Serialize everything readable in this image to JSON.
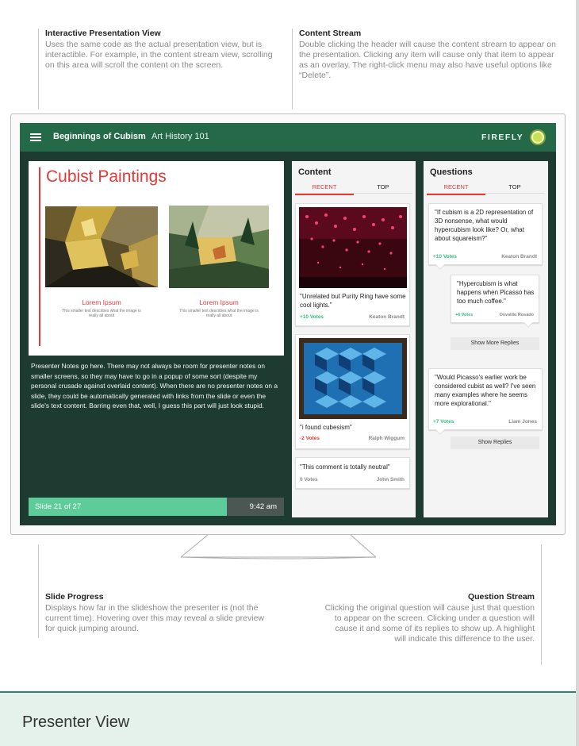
{
  "annotations": {
    "presentation_view": {
      "title": "Interactive Presentation View",
      "text": "Uses the same code as the actual presentation view, but is interactible. For example, in the content stream view, scrolling on this area will scroll the content on the screen."
    },
    "content_stream": {
      "title": "Content Stream",
      "text": "Double clicking the header will cause the content stream to appear on the presentation. Clicking any item will cause only that item to appear as an overlay. The right-click menu may also have useful options like “Delete”."
    },
    "slide_progress": {
      "title": "Slide Progress",
      "text": "Displays how far in the slideshow the presenter is (not the current time). Hovering over this may reveal a slide preview for quick jumping around."
    },
    "question_stream": {
      "title": "Question Stream",
      "text": "Clicking the original question will cause just that question to appear on the screen. Clicking under a question will cause it and some of its replies to show up. A highlight will indicate this difference to the user."
    }
  },
  "header": {
    "title": "Beginnings of Cubism",
    "course": "Art History 101",
    "brand": "FIREFLY",
    "icons": [
      "menu-icon",
      "live-status-icon"
    ],
    "accent": "#246a48"
  },
  "slide": {
    "title": "Cubist Paintings",
    "accent": "#e53935",
    "images": [
      {
        "caption": "Lorem Ipsum",
        "subtext": "This smaller text describes what the image is really all about"
      },
      {
        "caption": "Lorem Ipsum",
        "subtext": "This smaller text describes what the image is really all about"
      }
    ]
  },
  "notes": "Presenter Notes go here. There may not always be room for presenter notes on smaller screens, so they may have to go in a popup of some sort (despite my personal crusade against overlaid content). When there are no presenter notes on a slide, they could be automatically generated with links from the slide or even the slide's text content. Barring even that, well, I guess this part will just look stupid.",
  "progress": {
    "label": "Slide 21 of 27",
    "current": 21,
    "total": 27,
    "time": "9:42 am"
  },
  "content_panel": {
    "title": "Content",
    "tabs": [
      "RECENT",
      "TOP"
    ],
    "items": [
      {
        "text": "\"Unrelated but Purity Ring have some cool lights.\"",
        "votes": "+10 Votes",
        "author": "Keaton Brandt"
      },
      {
        "text": "\"i found cubesism\"",
        "votes": "-2 Votes",
        "author": "Ralph Wiggum"
      },
      {
        "text": "\"This comment is totally neutral\"",
        "votes": "0 Votes",
        "author": "John Smith"
      }
    ]
  },
  "questions_panel": {
    "title": "Questions",
    "tabs": [
      "RECENT",
      "TOP"
    ],
    "questions": [
      {
        "text": "\"If cubism is a 2D representation of 3D nonsense, what would hypercubism look like? Or, what about squareism?\"",
        "votes": "+10 Votes",
        "author": "Keaton Brandt",
        "reply": {
          "text": "\"Hypercubism is what happens when Picasso has too much coffee.\"",
          "votes": "+6 Votes",
          "author": "Osvaldo Rosado"
        },
        "button": "Show More Replies"
      },
      {
        "text": "\"Would Picasso's earlier work be considered cubist as well? I've seen many examples where he seems more explorational.\"",
        "votes": "+7 Votes",
        "author": "Liam Jones",
        "button": "Show Replies"
      }
    ]
  },
  "footer": {
    "title": "Presenter View"
  }
}
